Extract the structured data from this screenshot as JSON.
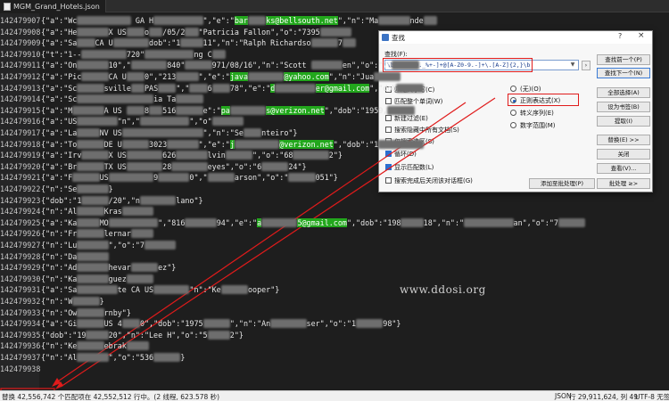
{
  "tab": {
    "title": "MGM_Grand_Hotels.json"
  },
  "lines": [
    {
      "n": "142479907",
      "parts": [
        [
          "t",
          "{\"a\":\"Wc"
        ],
        [
          "b",
          "xxxxxxxxxxxx"
        ],
        [
          "t",
          " GA H"
        ],
        [
          "b",
          "xxxxxxxxxxx"
        ],
        [
          "t",
          "\",\"e\":\""
        ],
        [
          "g",
          "bar"
        ],
        [
          "b",
          "xxxx"
        ],
        [
          "g",
          "ks@bellsouth.net"
        ],
        [
          "t",
          "\",\"n\":\"Ma"
        ],
        [
          "b",
          "xxxxxxx"
        ],
        [
          "t",
          "nde"
        ],
        [
          "b",
          "xxx"
        ]
      ]
    },
    {
      "n": "142479908",
      "parts": [
        [
          "t",
          "{\"a\":\"He"
        ],
        [
          "b",
          "xxxxxxx"
        ],
        [
          "t",
          "X US"
        ],
        [
          "b",
          "xxxx"
        ],
        [
          "t",
          "o"
        ],
        [
          "b",
          "xxx"
        ],
        [
          "t",
          "/05/2"
        ],
        [
          "b",
          "xxx"
        ],
        [
          "t",
          "\"Patricia Fallon\",\"o\":\"7395"
        ],
        [
          "b",
          "xxxxxxx"
        ]
      ]
    },
    {
      "n": "142479909",
      "parts": [
        [
          "t",
          "{\"a\":\"Sa"
        ],
        [
          "b",
          "xxxx"
        ],
        [
          "t",
          "CA U"
        ],
        [
          "b",
          "xxxxxxxx"
        ],
        [
          "t",
          "dob\":\"1"
        ],
        [
          "b",
          "xxxxx"
        ],
        [
          "t",
          "11\",\"n\":\"Ralph Richardso"
        ],
        [
          "b",
          "xxxxxx"
        ],
        [
          "t",
          "7"
        ],
        [
          "b",
          "xxx"
        ]
      ]
    },
    {
      "n": "142479910",
      "parts": [
        [
          "t",
          "{\"t\":\"1--"
        ],
        [
          "b",
          "xxxxxxxxxx"
        ],
        [
          "t",
          "720\""
        ],
        [
          "b",
          "xxxxxxxxxxx"
        ],
        [
          "t",
          "ng C"
        ],
        [
          "b",
          "xxx"
        ]
      ]
    },
    {
      "n": "142479911",
      "parts": [
        [
          "t",
          "{\"a\":\"On"
        ],
        [
          "b",
          "xxxxxxx"
        ],
        [
          "t",
          "10\",\""
        ],
        [
          "b",
          "xxxxxxxx"
        ],
        [
          "t",
          "840\""
        ],
        [
          "b",
          "xxxxxx"
        ],
        [
          "t",
          "971/08/16\",\"n\":\"Scott "
        ],
        [
          "b",
          "xxxxxxx"
        ],
        [
          "t",
          "en\",\"o\":\"70"
        ],
        [
          "b",
          "xxxxxx"
        ]
      ]
    },
    {
      "n": "142479912",
      "parts": [
        [
          "t",
          "{\"a\":\"Pic"
        ],
        [
          "b",
          "xxxxxx"
        ],
        [
          "t",
          "CA U"
        ],
        [
          "b",
          "xxxx"
        ],
        [
          "t",
          "0\",\"213"
        ],
        [
          "b",
          "xxxxx"
        ],
        [
          "t",
          "\",\"e\":\""
        ],
        [
          "g",
          "java"
        ],
        [
          "b",
          "xxxxxxxx"
        ],
        [
          "g",
          "@yahoo.com"
        ],
        [
          "t",
          "\",\"n\":\"Jua"
        ],
        [
          "b",
          "xxxxxx"
        ]
      ]
    },
    {
      "n": "142479913",
      "parts": [
        [
          "t",
          "{\"a\":\"Sc"
        ],
        [
          "b",
          "xxxxxx"
        ],
        [
          "t",
          "sville"
        ],
        [
          "b",
          "xxx"
        ],
        [
          "t",
          "PAS"
        ],
        [
          "b",
          "xxxx"
        ],
        [
          "t",
          "\",\""
        ],
        [
          "b",
          "xxxx"
        ],
        [
          "t",
          "6"
        ],
        [
          "b",
          "xxxx"
        ],
        [
          "t",
          "78\",\"e\":\""
        ],
        [
          "g",
          "d"
        ],
        [
          "b",
          "xxxxxxxxx"
        ],
        [
          "g",
          "er@gmail.com"
        ],
        [
          "t",
          "\",\"dob"
        ],
        [
          "b",
          "xxxxxx"
        ]
      ]
    },
    {
      "n": "142479914",
      "parts": [
        [
          "t",
          "{\"a\":\"Sc"
        ],
        [
          "b",
          "xxxxxxxxxxxxxxxxx"
        ],
        [
          "t",
          "ia Ta"
        ],
        [
          "b",
          "xxxxxx"
        ]
      ]
    },
    {
      "n": "142479915",
      "parts": [
        [
          "t",
          "{\"a\":\"M"
        ],
        [
          "b",
          "xxxxxxx"
        ],
        [
          "t",
          "A US "
        ],
        [
          "b",
          "xxxx"
        ],
        [
          "t",
          "8"
        ],
        [
          "b",
          "xxx"
        ],
        [
          "t",
          "516"
        ],
        [
          "b",
          "xxxxxx"
        ],
        [
          "t",
          "e\":\""
        ],
        [
          "g",
          "pa"
        ],
        [
          "b",
          "xxxxxxxx"
        ],
        [
          "g",
          "s@verizon.net"
        ],
        [
          "t",
          "\",\"dob\":\"1959,"
        ],
        [
          "b",
          "xxxxxx"
        ]
      ]
    },
    {
      "n": "142479916",
      "parts": [
        [
          "t",
          "{\"a\":\"US"
        ],
        [
          "b",
          "xxxxxxxxx"
        ],
        [
          "t",
          "\"n\",\""
        ],
        [
          "b",
          "xxxxxxxxxxx"
        ],
        [
          "t",
          "\",\"o\""
        ],
        [
          "b",
          "xxxxxxx"
        ]
      ]
    },
    {
      "n": "142479917",
      "parts": [
        [
          "t",
          "{\"a\":\"La"
        ],
        [
          "b",
          "xxxxx"
        ],
        [
          "t",
          "NV US"
        ],
        [
          "b",
          "xxxxxxxxxxxxxxxxxx"
        ],
        [
          "t",
          "\",\"n\":\"Se"
        ],
        [
          "b",
          "xxxx"
        ],
        [
          "t",
          "nteiro\"}"
        ]
      ]
    },
    {
      "n": "142479918",
      "parts": [
        [
          "t",
          "{\"a\":\"To"
        ],
        [
          "b",
          "xxxxxx"
        ],
        [
          "t",
          "DE U"
        ],
        [
          "b",
          "xxxxxx"
        ],
        [
          "t",
          "3023"
        ],
        [
          "b",
          "xxxxxxx"
        ],
        [
          "t",
          "\",\"e\":\""
        ],
        [
          "g",
          "j"
        ],
        [
          "b",
          "xxxxxxxxxx"
        ],
        [
          "g",
          "@verizon.net"
        ],
        [
          "t",
          "\",\"dob\":\"1"
        ],
        [
          "b",
          "xxxxxxxxxx"
        ]
      ]
    },
    {
      "n": "142479919",
      "parts": [
        [
          "t",
          "{\"a\":\"Irv"
        ],
        [
          "b",
          "xxxxxx"
        ],
        [
          "t",
          "X US"
        ],
        [
          "b",
          "xxxxxxxx"
        ],
        [
          "t",
          "626"
        ],
        [
          "b",
          "xxxxxxx"
        ],
        [
          "t",
          "lvin"
        ],
        [
          "b",
          "xxxxxx"
        ],
        [
          "t",
          "\",\"o\":\"68"
        ],
        [
          "b",
          "xxxxxxxx"
        ],
        [
          "t",
          "2\"}"
        ]
      ]
    },
    {
      "n": "142479920",
      "parts": [
        [
          "t",
          "{\"a\":\"Br"
        ],
        [
          "b",
          "xxxxxx"
        ],
        [
          "t",
          "TX US"
        ],
        [
          "b",
          "xxxxxxxx"
        ],
        [
          "t",
          "28"
        ],
        [
          "b",
          "xxxxxxxx"
        ],
        [
          "t",
          "eyes\",\"o\":\"6"
        ],
        [
          "b",
          "xxxxxx"
        ],
        [
          "t",
          "24\"}"
        ]
      ]
    },
    {
      "n": "142479921",
      "parts": [
        [
          "t",
          "{\"a\":\"F"
        ],
        [
          "b",
          "xxxxxx"
        ],
        [
          "t",
          "US"
        ],
        [
          "b",
          "xxxxxxxxxx"
        ],
        [
          "t",
          "9"
        ],
        [
          "b",
          "xxxxxxx"
        ],
        [
          "t",
          "0\",\""
        ],
        [
          "b",
          "xxxxxx"
        ],
        [
          "t",
          "arson\",\"o\":\""
        ],
        [
          "b",
          "xxxxxx"
        ],
        [
          "t",
          "051\"}"
        ]
      ]
    },
    {
      "n": "142479922",
      "parts": [
        [
          "t",
          "{\"n\":\"Se"
        ],
        [
          "b",
          "xxxxxxx"
        ],
        [
          "t",
          "}"
        ]
      ]
    },
    {
      "n": "142479923",
      "parts": [
        [
          "t",
          "{\"dob\":\"1"
        ],
        [
          "b",
          "xxxxxx"
        ],
        [
          "t",
          "/20\",\"n"
        ],
        [
          "b",
          "xxxxxxxx"
        ],
        [
          "t",
          "lano\"}"
        ]
      ]
    },
    {
      "n": "142479924",
      "parts": [
        [
          "t",
          "{\"n\":\"Al"
        ],
        [
          "b",
          "xxxxxx"
        ],
        [
          "t",
          "Kras"
        ],
        [
          "b",
          "xxxxxxx"
        ]
      ]
    },
    {
      "n": "142479925",
      "parts": [
        [
          "t",
          "{\"a\":\"Ka"
        ],
        [
          "b",
          "xxxxx"
        ],
        [
          "t",
          "MO"
        ],
        [
          "b",
          "xxxxxxxxxxx"
        ],
        [
          "t",
          "\",\"816"
        ],
        [
          "b",
          "xxxxxxx"
        ],
        [
          "t",
          "94\",\"e\":\""
        ],
        [
          "g",
          "a"
        ],
        [
          "b",
          "xxxxxxxx"
        ],
        [
          "g",
          "5@gmail.com"
        ],
        [
          "t",
          "\",\"dob\":\"198"
        ],
        [
          "b",
          "xxxxx"
        ],
        [
          "t",
          "18\",\"n\":\""
        ],
        [
          "b",
          "xxxxxxxxxxx"
        ],
        [
          "t",
          "an\",\"o\":\"7"
        ],
        [
          "b",
          "xxxxxx"
        ]
      ]
    },
    {
      "n": "142479926",
      "parts": [
        [
          "t",
          "{\"n\":\"Fr"
        ],
        [
          "b",
          "xxxxxx"
        ],
        [
          "t",
          "lernar"
        ],
        [
          "b",
          "xxxxx"
        ]
      ]
    },
    {
      "n": "142479927",
      "parts": [
        [
          "t",
          "{\"n\":\"Lu"
        ],
        [
          "b",
          "xxxxxxx"
        ],
        [
          "t",
          "\",\"o\":\"7"
        ],
        [
          "b",
          "xxxxxxx"
        ]
      ]
    },
    {
      "n": "142479928",
      "parts": [
        [
          "t",
          "{\"n\":\"Da"
        ],
        [
          "b",
          "xxxxxxx"
        ]
      ]
    },
    {
      "n": "142479929",
      "parts": [
        [
          "t",
          "{\"n\":\"Ad"
        ],
        [
          "b",
          "xxxxxxx"
        ],
        [
          "t",
          "hevar"
        ],
        [
          "b",
          "xxxxxx"
        ],
        [
          "t",
          "ez\"}"
        ]
      ]
    },
    {
      "n": "142479930",
      "parts": [
        [
          "t",
          "{\"n\":\"Ka"
        ],
        [
          "b",
          "xxxxxxx"
        ],
        [
          "t",
          "guez"
        ],
        [
          "b",
          "xxxxxx"
        ]
      ]
    },
    {
      "n": "142479931",
      "parts": [
        [
          "t",
          "{\"a\":\"Sa"
        ],
        [
          "b",
          "xxxxxxxxx"
        ],
        [
          "t",
          "te CA US"
        ],
        [
          "b",
          "xxxxxxxx"
        ],
        [
          "t",
          "\"n\":\"Ke"
        ],
        [
          "b",
          "xxxxxx"
        ],
        [
          "t",
          "ooper\"}"
        ]
      ]
    },
    {
      "n": "142479932",
      "parts": [
        [
          "t",
          "{\"n\":\"W"
        ],
        [
          "b",
          "xxxxxx"
        ],
        [
          "t",
          "}"
        ]
      ]
    },
    {
      "n": "142479933",
      "parts": [
        [
          "t",
          "{\"n\":\"Ow"
        ],
        [
          "b",
          "xxxxxx"
        ],
        [
          "t",
          "rnby\"}"
        ]
      ]
    },
    {
      "n": "142479934",
      "parts": [
        [
          "t",
          "{\"a\":\"Gi"
        ],
        [
          "b",
          "xxxxxx"
        ],
        [
          "t",
          "US 4"
        ],
        [
          "b",
          "xxxx"
        ],
        [
          "t",
          "0\",\"dob\":\"1975"
        ],
        [
          "b",
          "xxxxxx"
        ],
        [
          "t",
          "\",\"n\":\"An"
        ],
        [
          "b",
          "xxxxxxxx"
        ],
        [
          "t",
          "ser\",\"o\":\"1"
        ],
        [
          "b",
          "xxxxxx"
        ],
        [
          "t",
          "98\"}"
        ]
      ]
    },
    {
      "n": "142479935",
      "parts": [
        [
          "t",
          "{\"dob\":\"19"
        ],
        [
          "b",
          "xxxxx"
        ],
        [
          "t",
          "20\",\"n\":\"Lee H\",\"o\":\"5"
        ],
        [
          "b",
          "xxxxx"
        ],
        [
          "t",
          "2\"}"
        ]
      ]
    },
    {
      "n": "142479936",
      "parts": [
        [
          "t",
          "{\"n\":\"Ke"
        ],
        [
          "b",
          "xxxxxx"
        ],
        [
          "t",
          "ebrak"
        ],
        [
          "b",
          "xxxxx"
        ]
      ]
    },
    {
      "n": "142479937",
      "parts": [
        [
          "t",
          "{\"n\":\"Al"
        ],
        [
          "b",
          "xxxxxxx"
        ],
        [
          "t",
          "\",\"o\":\"536"
        ],
        [
          "b",
          "xxxxxx"
        ],
        [
          "t",
          "}"
        ]
      ]
    },
    {
      "n": "142479938",
      "parts": []
    }
  ],
  "watermark": "www.ddosi.org",
  "status": {
    "left": "替换 42,556,742 个匹配项在 42,552,512 行中。(2 线程, 623.578 秒)",
    "lang": "JSON",
    "pos": "行 29,911,624, 列 49",
    "enc": "UTF-8 无签名"
  },
  "dialog": {
    "title": "查找",
    "help": "?",
    "close": "×",
    "find_label": "查找(F):",
    "find_value": "\\b[A-Z0-9._%+-]+@[A-Z0-9.-]+\\.[A-Z]{2,}\\b",
    "chk_case": "匹配大小写(C)",
    "chk_word": "匹配整个单词(W)",
    "chk_newline": "新建过滤(E)",
    "chk_hidden": "搜索隐藏中所有文档(S)",
    "chk_selection": "仅搜索选区(S)",
    "chk_wrap": "循环(D)",
    "chk_tokens": "显示匹配数(L)",
    "chk_close": "搜索完成后关闭该对话框(G)",
    "radio_none": "(无)(O)",
    "radio_regex": "正则表达式(X)",
    "radio_escape": "转义序列(E)",
    "radio_range": "数字范围(M)",
    "btn_prev": "查找前一个(P)",
    "btn_next": "查找下一个(N)",
    "btn_select_all": "全部选择(A)",
    "btn_bookmark": "设为书签(B)",
    "btn_extract": "提取(I)",
    "btn_replace": "替换(E) >>",
    "btn_close": "关闭",
    "btn_count": "查看(V)...",
    "btn_batch_add": "添加至批处理(P)",
    "btn_batch": "批处理 ≥>"
  }
}
